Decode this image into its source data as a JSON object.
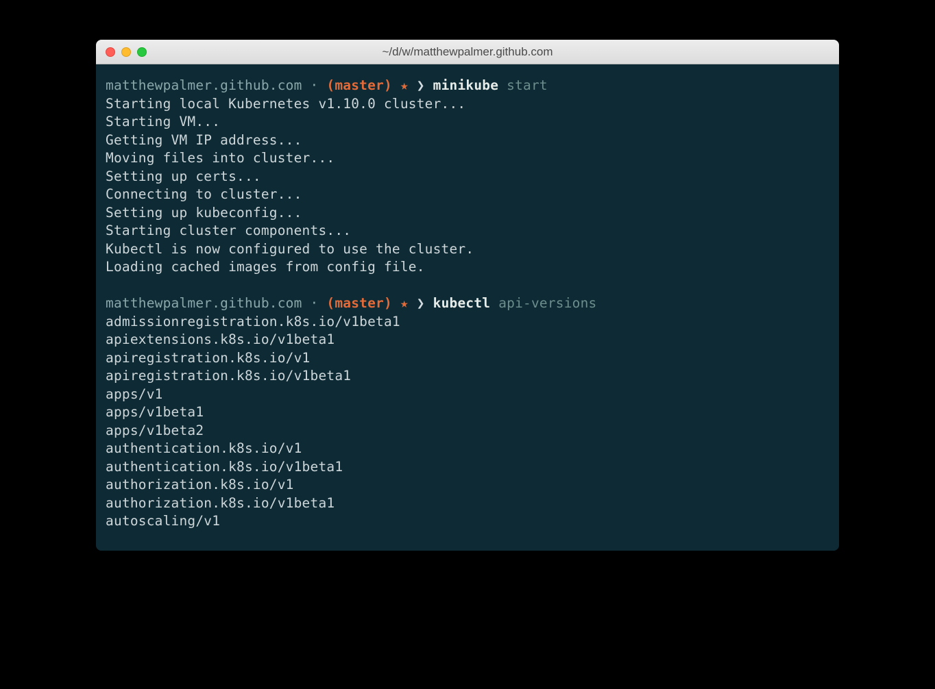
{
  "window": {
    "title": "~/d/w/matthewpalmer.github.com"
  },
  "prompt": {
    "path": "matthewpalmer.github.com",
    "dot": " · ",
    "branch": "(master)",
    "star": " ★ ",
    "caret": "❯ "
  },
  "blocks": [
    {
      "cmd": "minikube",
      "arg": "start",
      "output": [
        "Starting local Kubernetes v1.10.0 cluster...",
        "Starting VM...",
        "Getting VM IP address...",
        "Moving files into cluster...",
        "Setting up certs...",
        "Connecting to cluster...",
        "Setting up kubeconfig...",
        "Starting cluster components...",
        "Kubectl is now configured to use the cluster.",
        "Loading cached images from config file."
      ]
    },
    {
      "cmd": "kubectl",
      "arg": "api-versions",
      "output": [
        "admissionregistration.k8s.io/v1beta1",
        "apiextensions.k8s.io/v1beta1",
        "apiregistration.k8s.io/v1",
        "apiregistration.k8s.io/v1beta1",
        "apps/v1",
        "apps/v1beta1",
        "apps/v1beta2",
        "authentication.k8s.io/v1",
        "authentication.k8s.io/v1beta1",
        "authorization.k8s.io/v1",
        "authorization.k8s.io/v1beta1",
        "autoscaling/v1"
      ]
    }
  ]
}
